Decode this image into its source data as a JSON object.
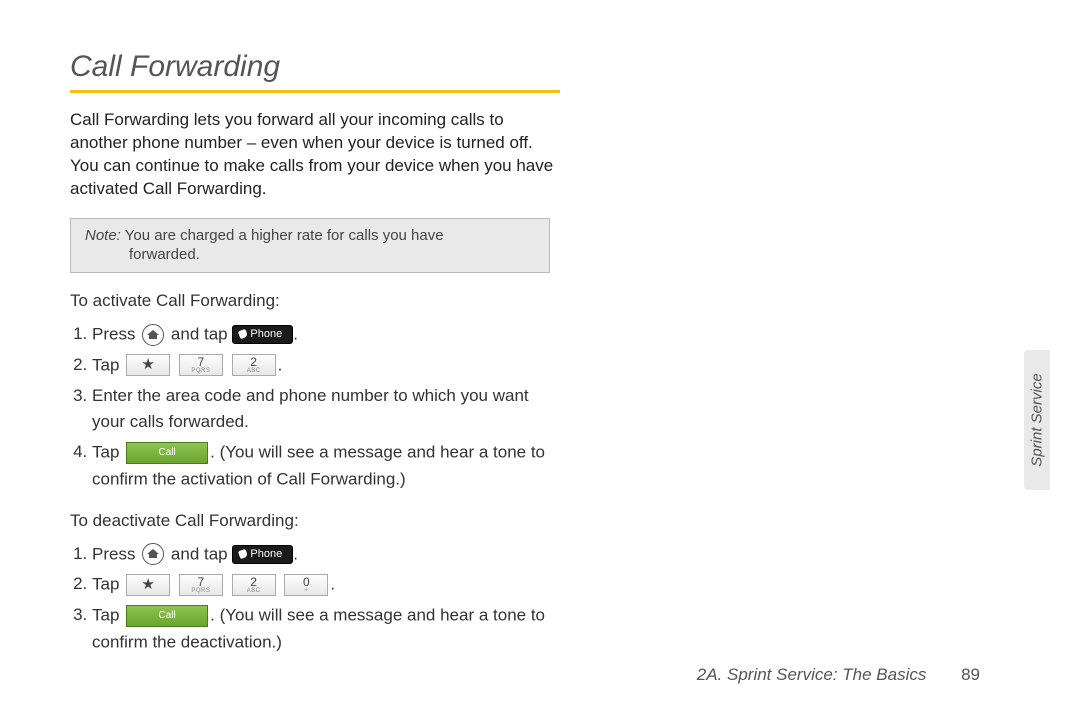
{
  "title": "Call Forwarding",
  "intro": "Call Forwarding lets you forward all your incoming calls to another phone number – even when your device is turned off. You can continue to make calls from your device when you have activated Call Forwarding.",
  "note": {
    "label": "Note:",
    "line1": "You are charged a higher rate for calls you have",
    "line2": "forwarded."
  },
  "activate": {
    "heading": "To activate Call Forwarding:",
    "step1_a": "Press ",
    "step1_b": " and tap ",
    "phone_label": "Phone",
    "step2": "Tap ",
    "star": "★",
    "key7_big": "7",
    "key7_small": "PQRS",
    "key2_big": "2",
    "key2_small": "ABC",
    "step3": "Enter the area code and phone number to which you want your calls forwarded.",
    "step4_a": "Tap ",
    "call_label": "Call",
    "step4_b": ". (You will see a message and hear a tone to confirm the activation of Call Forwarding.)"
  },
  "deactivate": {
    "heading": "To deactivate Call Forwarding:",
    "step1_a": "Press ",
    "step1_b": " and tap ",
    "step2": "Tap ",
    "key0_big": "0",
    "key0_small": "+",
    "step3_a": "Tap ",
    "step3_b": ". (You will see a message and hear a tone to confirm the deactivation.)"
  },
  "side_tab": "Sprint Service",
  "footer_section": "2A. Sprint Service: The Basics",
  "footer_page": "89"
}
